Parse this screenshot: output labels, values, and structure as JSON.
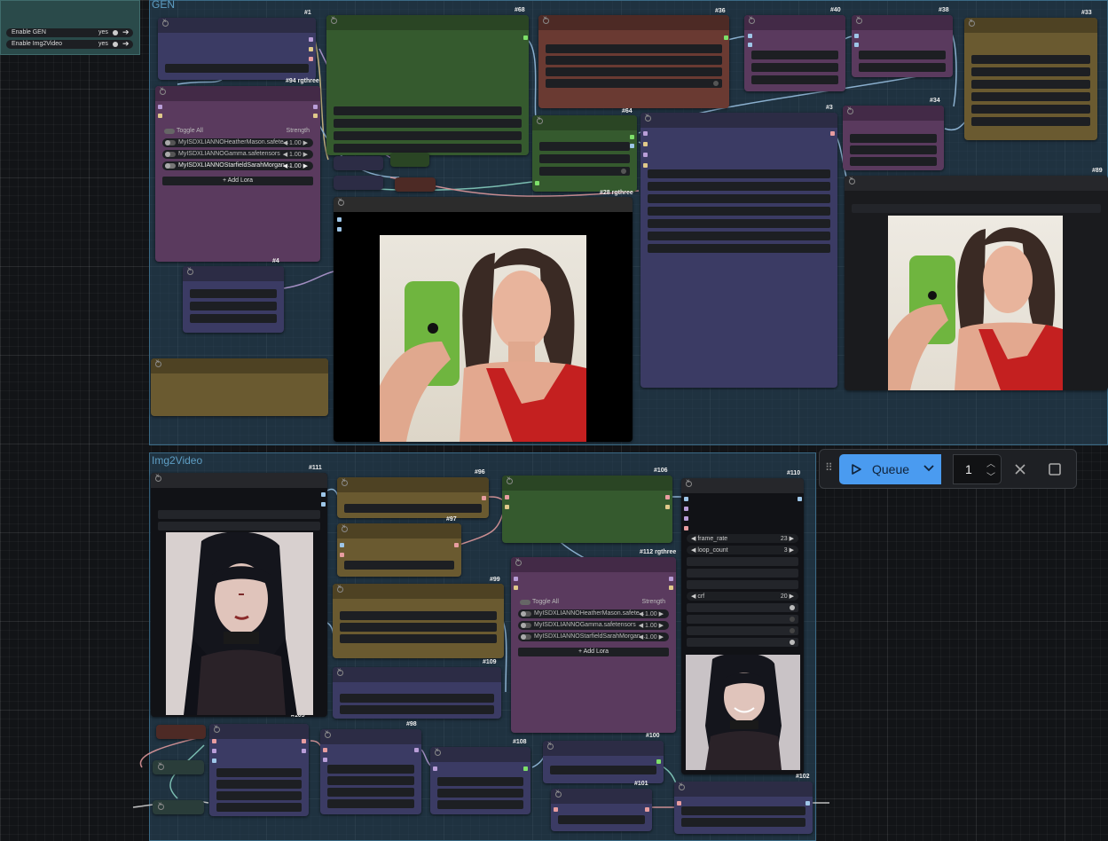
{
  "toggles_panel": {
    "items": [
      {
        "label": "Enable GEN",
        "value": "yes"
      },
      {
        "label": "Enable Img2Video",
        "value": "yes"
      }
    ]
  },
  "groups": {
    "gen": "GEN",
    "img2video": "Img2Video"
  },
  "node_ids": {
    "n1": "#1",
    "n68": "#68",
    "n36": "#36",
    "n40": "#40",
    "n38": "#38",
    "n33": "#33",
    "n94": "#94 rgthree",
    "n64": "#64",
    "n3": "#3",
    "n34": "#34",
    "n89": "#89",
    "n4": "#4",
    "n28": "#28 rgthree",
    "n111": "#111",
    "n96": "#96",
    "n97": "#97",
    "n106": "#106",
    "n110": "#110",
    "n112": "#112 rgthree",
    "n99": "#99",
    "n109": "#109",
    "n105": "#105",
    "n98": "#98",
    "n108": "#108",
    "n100": "#100",
    "n101": "#101",
    "n102": "#102"
  },
  "lora_gen": {
    "toggle_all": "Toggle All",
    "strength": "Strength",
    "rows": [
      {
        "name": "MyISDXLIANNOHeatherMason.safete...",
        "value": "1.00"
      },
      {
        "name": "MyISDXLIANNOGamma.safetensors",
        "value": "1.00"
      },
      {
        "name": "MyISDXLIANNOStarfieldSarahMorgan....",
        "value": "1.00"
      }
    ],
    "add": "+ Add Lora"
  },
  "lora_vid": {
    "toggle_all": "Toggle All",
    "strength": "Strength",
    "rows": [
      {
        "name": "MyISDXLIANNOHeatherMason.safete...",
        "value": "1.00"
      },
      {
        "name": "MyISDXLIANNOGamma.safetensors",
        "value": "1.00"
      },
      {
        "name": "MyISDXLIANNOStarfieldSarahMorgan....",
        "value": "1.00"
      }
    ],
    "add": "+ Add Lora"
  },
  "video_combine": {
    "frame_rate_label": "frame_rate",
    "frame_rate": "23",
    "loop_count_label": "loop_count",
    "loop_count": "3",
    "crf_label": "crf",
    "crf": "20"
  },
  "queue": {
    "label": "Queue",
    "count": "1"
  },
  "icons": {
    "play": "play-icon",
    "chevron": "chevron-down-icon",
    "close": "close-icon",
    "stop": "stop-square-icon",
    "drag": "drag-handle-icon"
  },
  "colors": {
    "accent": "#4a9bf0",
    "purple_node": "#5a3a5e",
    "green_node": "#355a2e",
    "blue_node": "#3b3b64",
    "brown_node": "#6a5a30",
    "red_node": "#6a3a32"
  }
}
